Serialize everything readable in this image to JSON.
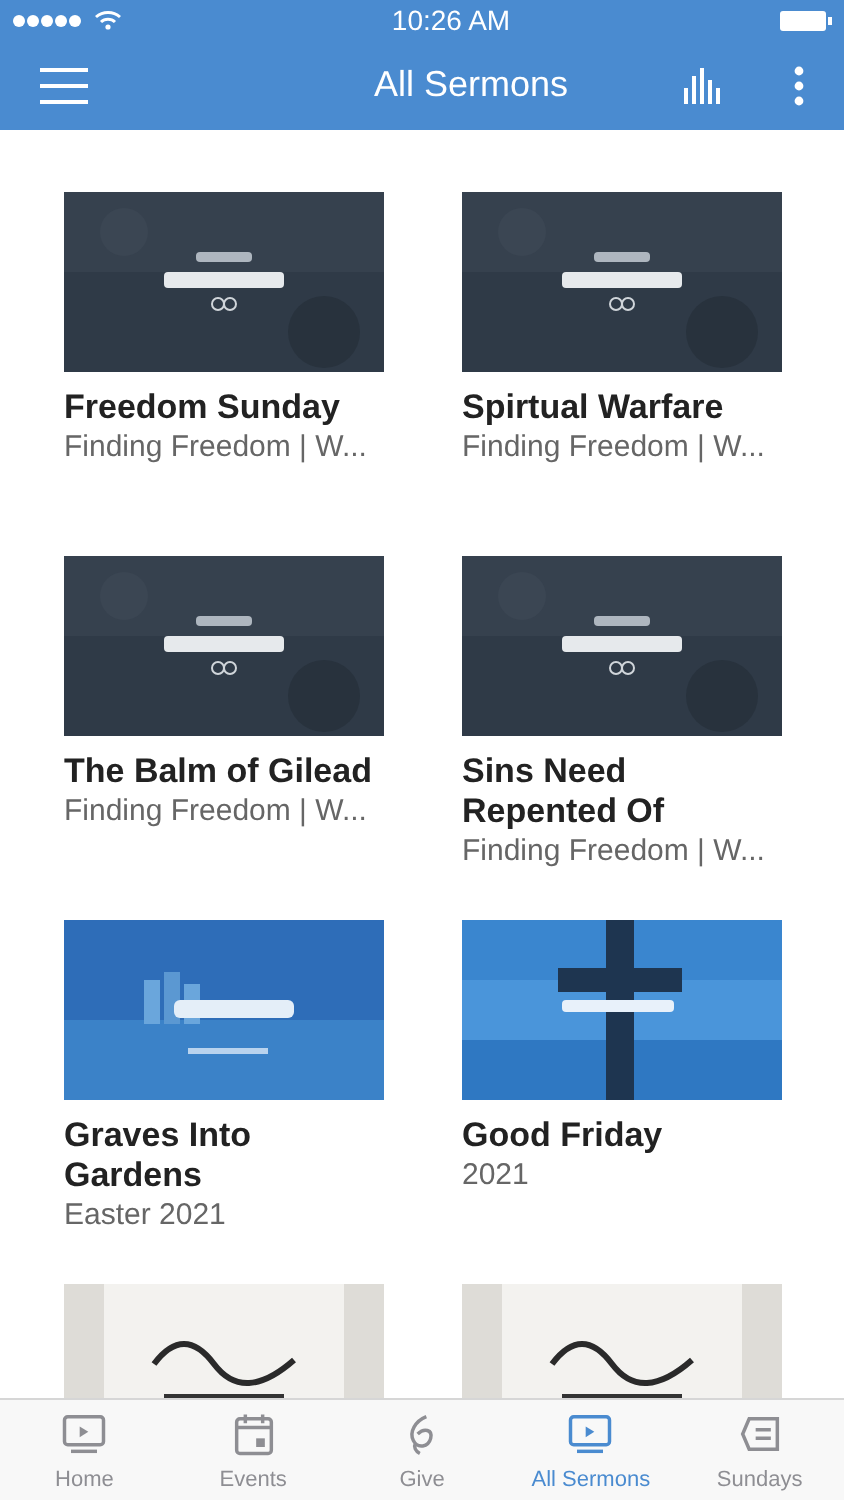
{
  "status_bar": {
    "time": "10:26 AM"
  },
  "header": {
    "title": "All Sermons"
  },
  "sermons": [
    {
      "thumbnail": {
        "kind": "picture"
      },
      "title": "Freedom Sunday",
      "subtitle": "Finding Freedom | W..."
    },
    {
      "thumbnail": {
        "kind": "picture"
      },
      "title": "Spirtual Warfare",
      "subtitle": "Finding Freedom | W..."
    },
    {
      "thumbnail": {
        "kind": "picture"
      },
      "title": "The Balm of Gilead",
      "subtitle": "Finding Freedom | W..."
    },
    {
      "thumbnail": {
        "kind": "picture"
      },
      "title": "Sins Need Repented Of",
      "subtitle": "Finding Freedom | W..."
    },
    {
      "thumbnail": {
        "kind": "picture"
      },
      "title": "Graves Into Gardens",
      "subtitle": "Easter 2021"
    },
    {
      "thumbnail": {
        "kind": "picture"
      },
      "title": "Good Friday",
      "subtitle": "2021"
    },
    {
      "thumbnail": {
        "kind": "picture"
      }
    },
    {
      "thumbnail": {
        "kind": "picture"
      }
    }
  ],
  "tabs": [
    {
      "label": "Home",
      "selected": false
    },
    {
      "label": "Events",
      "selected": false
    },
    {
      "label": "Give",
      "selected": false
    },
    {
      "label": "All Sermons",
      "selected": true
    },
    {
      "label": "Sundays",
      "selected": false
    }
  ]
}
